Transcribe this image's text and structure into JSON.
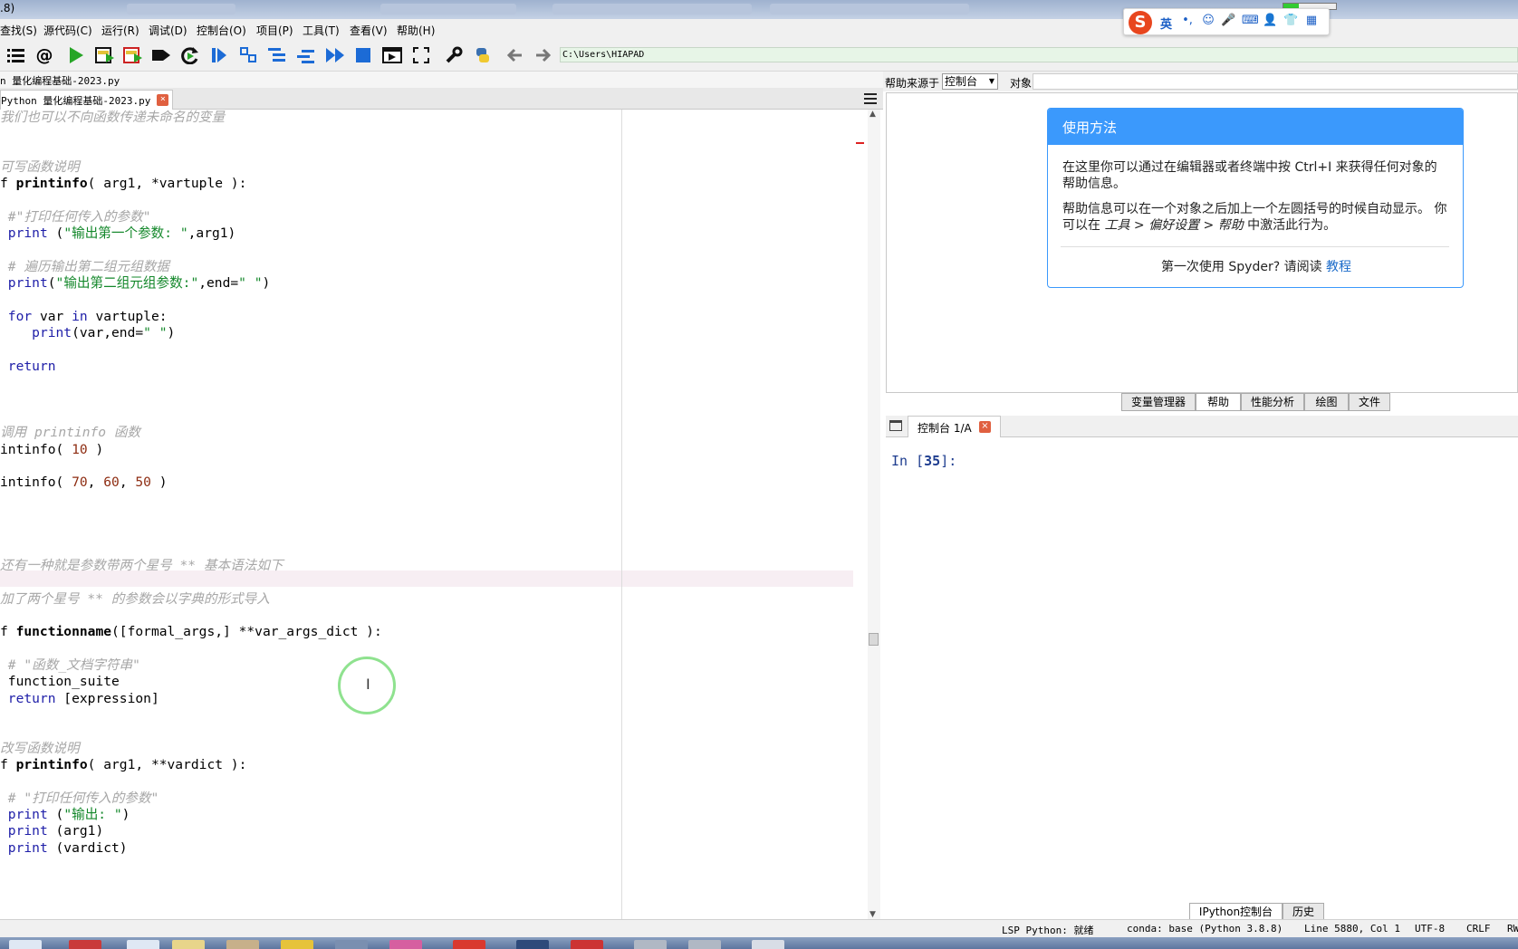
{
  "titlebar": {
    "fragment": ".8)"
  },
  "menu": [
    "查找(S)",
    "源代码(C)",
    "运行(R)",
    "调试(D)",
    "控制台(O)",
    "项目(P)",
    "工具(T)",
    "查看(V)",
    "帮助(H)"
  ],
  "ime": {
    "mode_label": "英"
  },
  "toolbar": {
    "path": "C:\\Users\\HIAPAD"
  },
  "editor": {
    "file_path": "n 量化编程基础-2023.py",
    "tab_label": "Python 量化编程基础-2023.py",
    "tab_close": "×",
    "lines": [
      [
        {
          "t": "我们也可以不向函数传递未命名的变量",
          "c": "cm"
        }
      ],
      [],
      [],
      [
        {
          "t": "可写函数说明",
          "c": "cm"
        }
      ],
      [
        {
          "t": "f "
        },
        {
          "t": "printinfo",
          "c": "fn"
        },
        {
          "t": "( arg1, *vartuple ):"
        }
      ],
      [],
      [
        {
          "t": " #\"打印任何传入的参数\"",
          "c": "cm"
        }
      ],
      [
        {
          "t": " "
        },
        {
          "t": "print",
          "c": "kw"
        },
        {
          "t": " ("
        },
        {
          "t": "\"输出第一个参数: \"",
          "c": "st"
        },
        {
          "t": ",arg1)"
        }
      ],
      [],
      [
        {
          "t": " # 遍历输出第二组元组数据",
          "c": "cm"
        }
      ],
      [
        {
          "t": " "
        },
        {
          "t": "print",
          "c": "kw"
        },
        {
          "t": "("
        },
        {
          "t": "\"输出第二组元组参数:\"",
          "c": "st"
        },
        {
          "t": ",end="
        },
        {
          "t": "\" \"",
          "c": "st"
        },
        {
          "t": ")"
        }
      ],
      [],
      [
        {
          "t": " "
        },
        {
          "t": "for",
          "c": "kw"
        },
        {
          "t": " var "
        },
        {
          "t": "in",
          "c": "kw"
        },
        {
          "t": " vartuple:"
        }
      ],
      [
        {
          "t": "    "
        },
        {
          "t": "print",
          "c": "kw"
        },
        {
          "t": "(var,end="
        },
        {
          "t": "\" \"",
          "c": "st"
        },
        {
          "t": ")"
        }
      ],
      [],
      [
        {
          "t": " "
        },
        {
          "t": "return",
          "c": "kw"
        }
      ],
      [],
      [],
      [],
      [
        {
          "t": "调用 printinfo 函数",
          "c": "cm"
        }
      ],
      [
        {
          "t": "intinfo( "
        },
        {
          "t": "10",
          "c": "nm"
        },
        {
          "t": " )"
        }
      ],
      [],
      [
        {
          "t": "intinfo( "
        },
        {
          "t": "70",
          "c": "nm"
        },
        {
          "t": ", "
        },
        {
          "t": "60",
          "c": "nm"
        },
        {
          "t": ", "
        },
        {
          "t": "50",
          "c": "nm"
        },
        {
          "t": " )"
        }
      ],
      [],
      [],
      [],
      [],
      [
        {
          "t": "还有一种就是参数带两个星号 ** 基本语法如下",
          "c": "cm"
        }
      ],
      [],
      [
        {
          "t": "加了两个星号 ** 的参数会以字典的形式导入",
          "c": "cm"
        }
      ],
      [],
      [
        {
          "t": "f "
        },
        {
          "t": "functionname",
          "c": "fn"
        },
        {
          "t": "([formal_args,] **var_args_dict ):"
        }
      ],
      [],
      [
        {
          "t": " # \"函数_文档字符串\"",
          "c": "cm"
        }
      ],
      [
        {
          "t": " function_suite"
        }
      ],
      [
        {
          "t": " "
        },
        {
          "t": "return",
          "c": "kw"
        },
        {
          "t": " [expression]"
        }
      ],
      [],
      [],
      [
        {
          "t": "改写函数说明",
          "c": "cm"
        }
      ],
      [
        {
          "t": "f "
        },
        {
          "t": "printinfo",
          "c": "fn"
        },
        {
          "t": "( arg1, **vardict ):"
        }
      ],
      [],
      [
        {
          "t": " # \"打印任何传入的参数\"",
          "c": "cm"
        }
      ],
      [
        {
          "t": " "
        },
        {
          "t": "print",
          "c": "kw"
        },
        {
          "t": " ("
        },
        {
          "t": "\"输出: \"",
          "c": "st"
        },
        {
          "t": ")"
        }
      ],
      [
        {
          "t": " "
        },
        {
          "t": "print",
          "c": "kw"
        },
        {
          "t": " (arg1)"
        }
      ],
      [
        {
          "t": " "
        },
        {
          "t": "print",
          "c": "kw"
        },
        {
          "t": " (vardict)"
        }
      ]
    ]
  },
  "help": {
    "source_label": "帮助来源于",
    "source_value": "控制台",
    "object_label": "对象",
    "card_title": "使用方法",
    "p1": "在这里你可以通过在编辑器或者终端中按 Ctrl+I 来获得任何对象的帮助信息。",
    "p2_a": "帮助信息可以在一个对象之后加上一个左圆括号的时候自动显示。 你可以在 ",
    "p2_b": "工具 > 偏好设置 > 帮助",
    "p2_c": " 中激活此行为。",
    "footer_a": "第一次使用 Spyder? 请阅读 ",
    "footer_link": "教程"
  },
  "panes_top": [
    "变量管理器",
    "帮助",
    "性能分析",
    "绘图",
    "文件"
  ],
  "console": {
    "tab_label": "控制台 1/A",
    "tab_close": "×",
    "prompt_in": "In [",
    "prompt_num": "35",
    "prompt_end": "]:"
  },
  "panes_bottom": [
    "IPython控制台",
    "历史"
  ],
  "status": {
    "lsp": "LSP Python: 就绪",
    "conda": "conda: base (Python 3.8.8)",
    "position": "Line 5880, Col 1",
    "encoding": "UTF-8",
    "eol": "CRLF",
    "rw": "RW"
  }
}
